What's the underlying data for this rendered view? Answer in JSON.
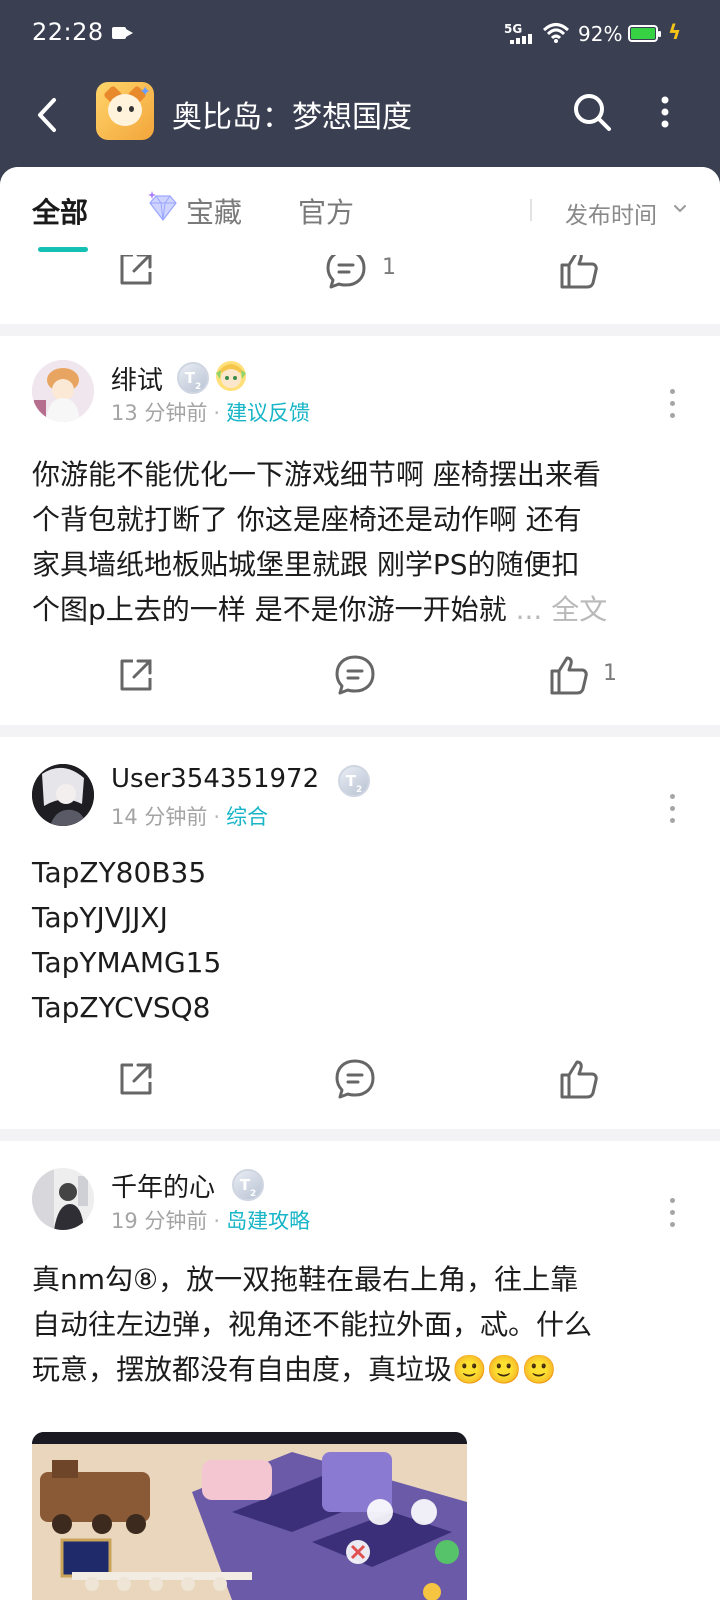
{
  "status_bar": {
    "time": "22:28",
    "network": "5G",
    "battery": "92%"
  },
  "header": {
    "title": "奥比岛：梦想国度",
    "back_icon": "chevron-left-icon",
    "search_icon": "search-icon",
    "more_icon": "more-vertical-icon"
  },
  "tabs": {
    "items": [
      {
        "label": "全部",
        "active": true
      },
      {
        "label": "宝藏",
        "active": false
      },
      {
        "label": "官方",
        "active": false
      }
    ],
    "sort_label": "发布时间",
    "accent": "#14c0b4"
  },
  "top_action_bar": {
    "comment_count": "1"
  },
  "posts": [
    {
      "user": "绯试",
      "time": "13 分钟前",
      "topic": "建议反馈",
      "body_lines": [
        "你游能不能优化一下游戏细节啊 座椅摆出来看",
        "个背包就打断了 你这是座椅还是动作啊 还有",
        "家具墙纸地板贴城堡里就跟 刚学PS的随便扣",
        "个图p上去的一样 是不是你游一开始就"
      ],
      "ellipsis": "...",
      "more_label": "全文",
      "like_count": "1"
    },
    {
      "user": "User354351972",
      "time": "14 分钟前",
      "topic": "综合",
      "body_lines": [
        "TapZY80B35",
        "TapYJVJJXJ",
        "TapYMAMG15",
        "TapZYCVSQ8"
      ]
    },
    {
      "user": "千年的心",
      "time": "19 分钟前",
      "topic": "岛建攻略",
      "body_lines": [
        "真nm勾⑧，放一双拖鞋在最右上角，往上靠",
        "自动往左边弹，视角还不能拉外面，忒。什么",
        "玩意，摆放都没有自由度，真垃圾🙂🙂🙂"
      ]
    }
  ],
  "badge_letter": "T",
  "badge_level": "2",
  "topic_color": "#17b5c7"
}
